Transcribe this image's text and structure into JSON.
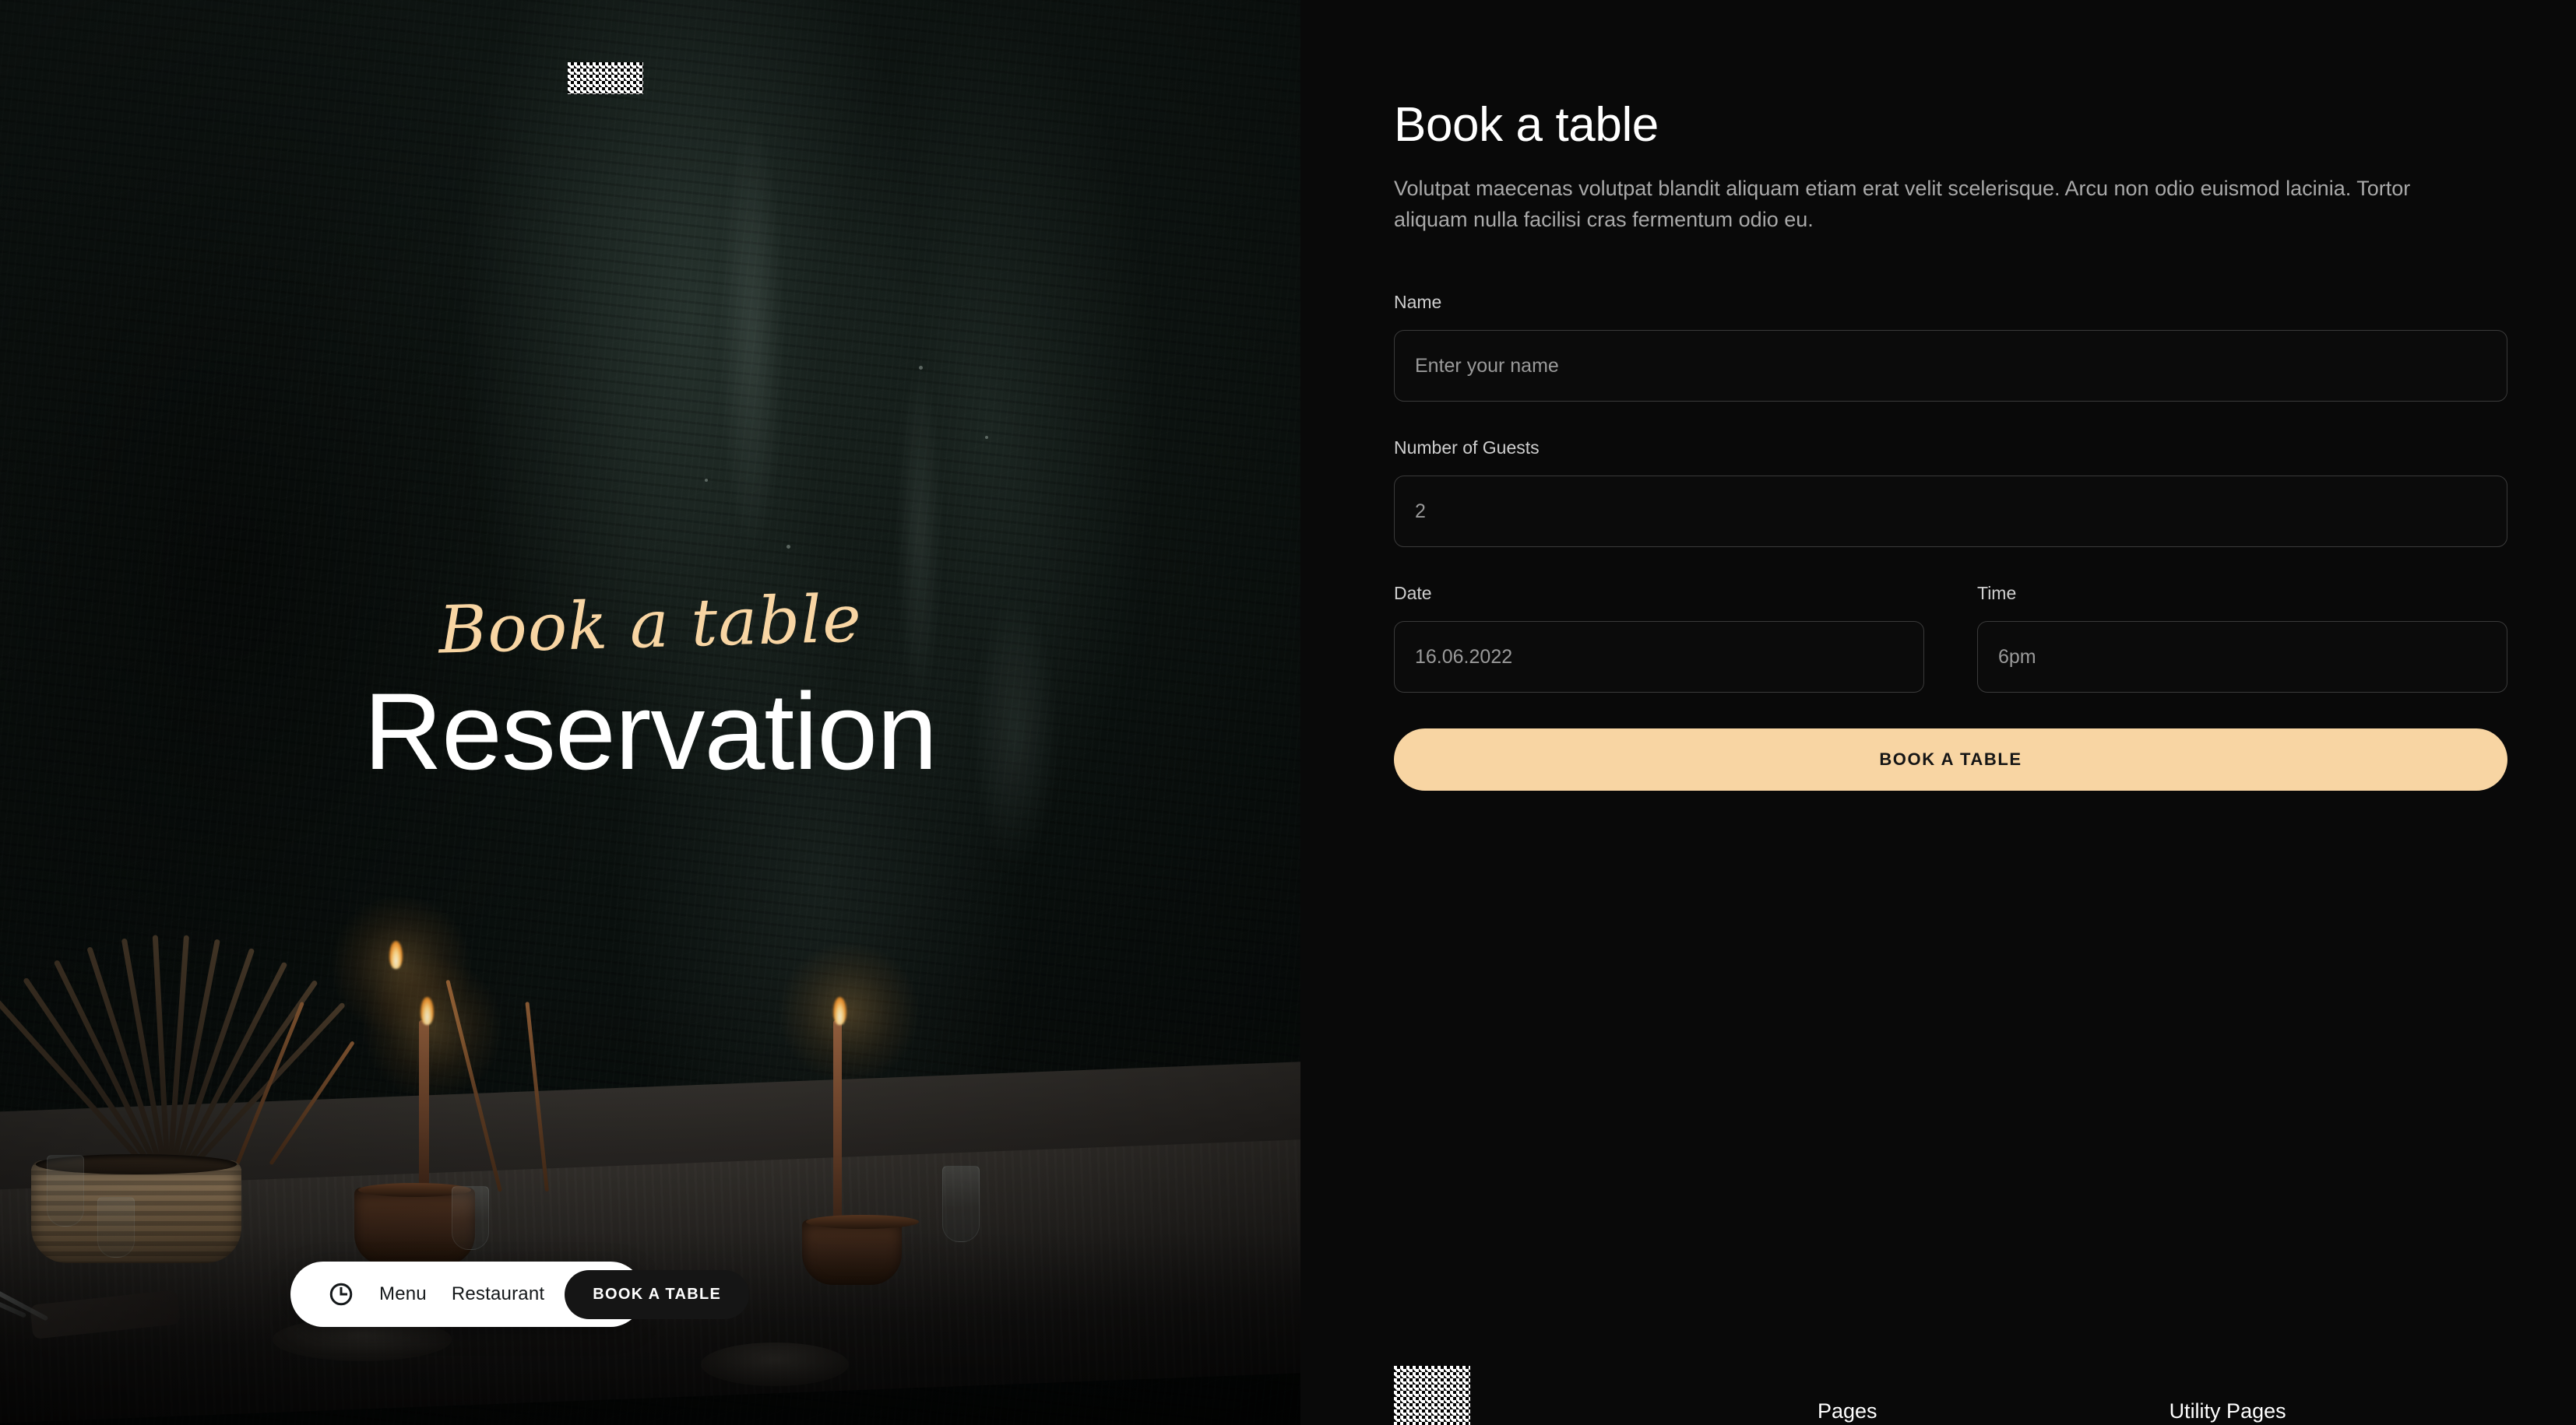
{
  "hero": {
    "logo_alt": "broken-image-placeholder",
    "script_title": "Book a table",
    "main_title": "Reservation",
    "nav": {
      "menu_icon": "hamburger-icon",
      "clock_icon": "clock-icon",
      "links": [
        {
          "label": "Menu"
        },
        {
          "label": "Restaurant"
        }
      ],
      "cta_label": "BOOK A TABLE"
    }
  },
  "panel": {
    "title": "Book a table",
    "description": "Volutpat maecenas volutpat blandit aliquam etiam erat velit scelerisque. Arcu non odio euismod lacinia. Tortor aliquam nulla facilisi cras fermentum odio eu.",
    "form": {
      "fields": [
        {
          "label": "Name",
          "value": "",
          "placeholder": "Enter your name"
        },
        {
          "label": "Number of Guests",
          "value": "2",
          "placeholder": "2"
        },
        {
          "label": "Date",
          "value": "16.06.2022",
          "placeholder": "16.06.2022"
        },
        {
          "label": "Time",
          "value": "6pm",
          "placeholder": "6pm"
        }
      ],
      "submit_label": "BOOK A TABLE"
    }
  },
  "footer": {
    "logo_alt": "broken-image-placeholder",
    "links": [
      {
        "label": "Pages"
      },
      {
        "label": "Utility Pages"
      }
    ]
  },
  "colors": {
    "accent": "#f8d5a3",
    "panel_bg": "#090909",
    "hero_bg": "#0c1210",
    "nav_pill_bg": "#ffffff",
    "nav_cta_bg": "#151515",
    "input_border": "#3a3a3a",
    "muted_text": "#a9a9a9"
  }
}
